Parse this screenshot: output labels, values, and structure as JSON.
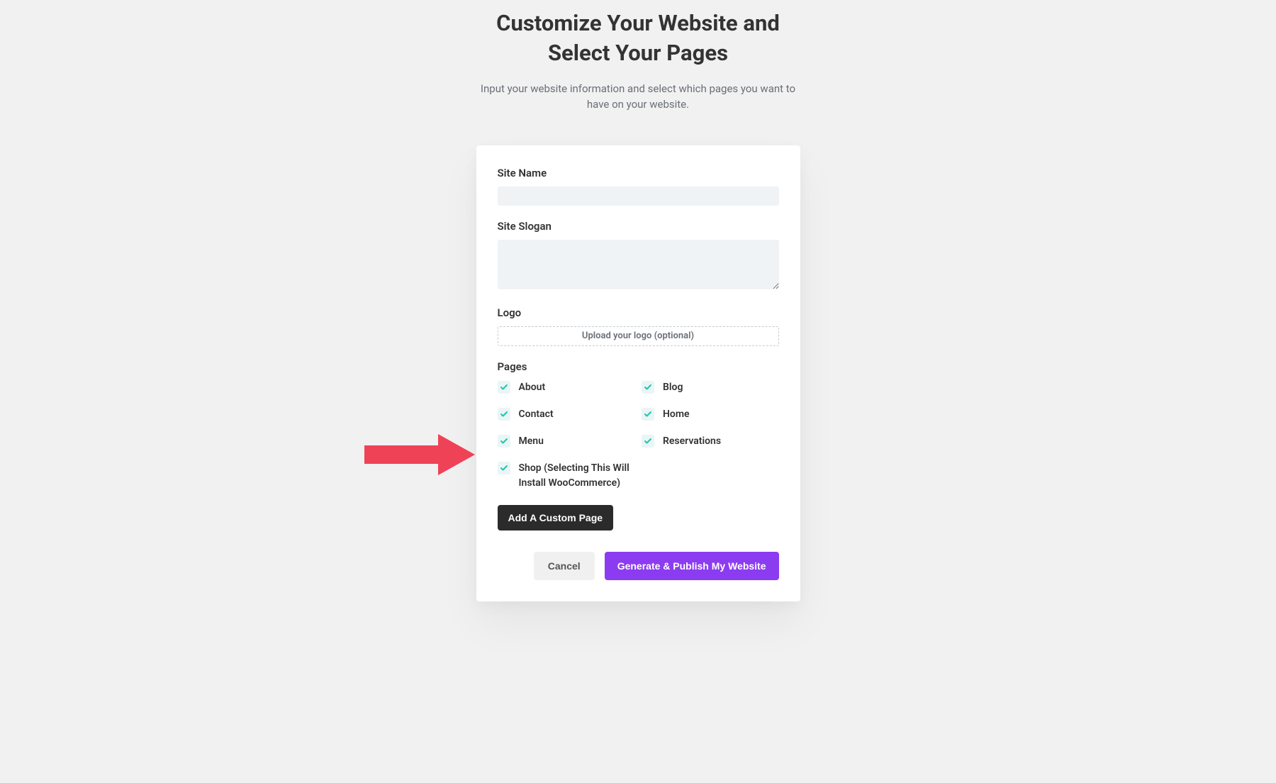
{
  "header": {
    "title_line1": "Customize Your Website and",
    "title_line2": "Select Your Pages",
    "subtitle": "Input your website information and select which pages you want to have on your website."
  },
  "form": {
    "site_name_label": "Site Name",
    "site_name_value": "",
    "site_slogan_label": "Site Slogan",
    "site_slogan_value": "",
    "logo_label": "Logo",
    "logo_upload_text": "Upload your logo (optional)",
    "pages_label": "Pages",
    "pages": [
      {
        "label": "About",
        "checked": true
      },
      {
        "label": "Blog",
        "checked": true
      },
      {
        "label": "Contact",
        "checked": true
      },
      {
        "label": "Home",
        "checked": true
      },
      {
        "label": "Menu",
        "checked": true
      },
      {
        "label": "Reservations",
        "checked": true
      },
      {
        "label": "Shop (Selecting This Will Install WooCommerce)",
        "checked": true
      }
    ],
    "add_custom_label": "Add A Custom Page"
  },
  "footer": {
    "cancel_label": "Cancel",
    "generate_label": "Generate & Publish My Website"
  },
  "colors": {
    "accent": "#8c3cf0",
    "checkbox_check": "#1fc4b3",
    "arrow": "#ef4257"
  }
}
